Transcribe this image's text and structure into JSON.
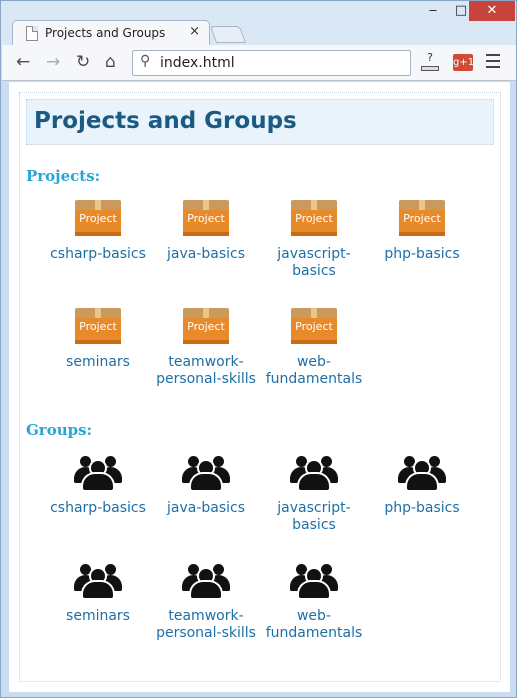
{
  "browser": {
    "tab_title": "Projects and Groups",
    "tab_close": "×",
    "win_minimize": "‒",
    "win_maximize": "□",
    "win_close": "✕",
    "back": "←",
    "forward": "→",
    "reload": "↻",
    "home": "⌂",
    "address": "index.html",
    "omnibox_icon": "⚲",
    "ext_question": "?",
    "ext_gplus": "g+1"
  },
  "page": {
    "title": "Projects and Groups",
    "projects_heading": "Projects:",
    "groups_heading": "Groups:",
    "project_icon_text": "Project",
    "projects": [
      {
        "label": "csharp-basics"
      },
      {
        "label": "java-basics"
      },
      {
        "label": "javascript-basics"
      },
      {
        "label": "php-basics"
      },
      {
        "label": "seminars"
      },
      {
        "label": "teamwork-personal-skills"
      },
      {
        "label": "web-fundamentals"
      }
    ],
    "groups": [
      {
        "label": "csharp-basics"
      },
      {
        "label": "java-basics"
      },
      {
        "label": "javascript-basics"
      },
      {
        "label": "php-basics"
      },
      {
        "label": "seminars"
      },
      {
        "label": "teamwork-personal-skills"
      },
      {
        "label": "web-fundamentals"
      }
    ]
  },
  "colors": {
    "title": "#1a5a83",
    "section_heading": "#27a6d6",
    "link": "#1d6fa8",
    "header_bg": "#e8f3fc",
    "box_orange": "#e98a2a",
    "close_red": "#c7443c"
  },
  "icons": {
    "project": "project-box-icon",
    "group": "people-group-icon"
  }
}
